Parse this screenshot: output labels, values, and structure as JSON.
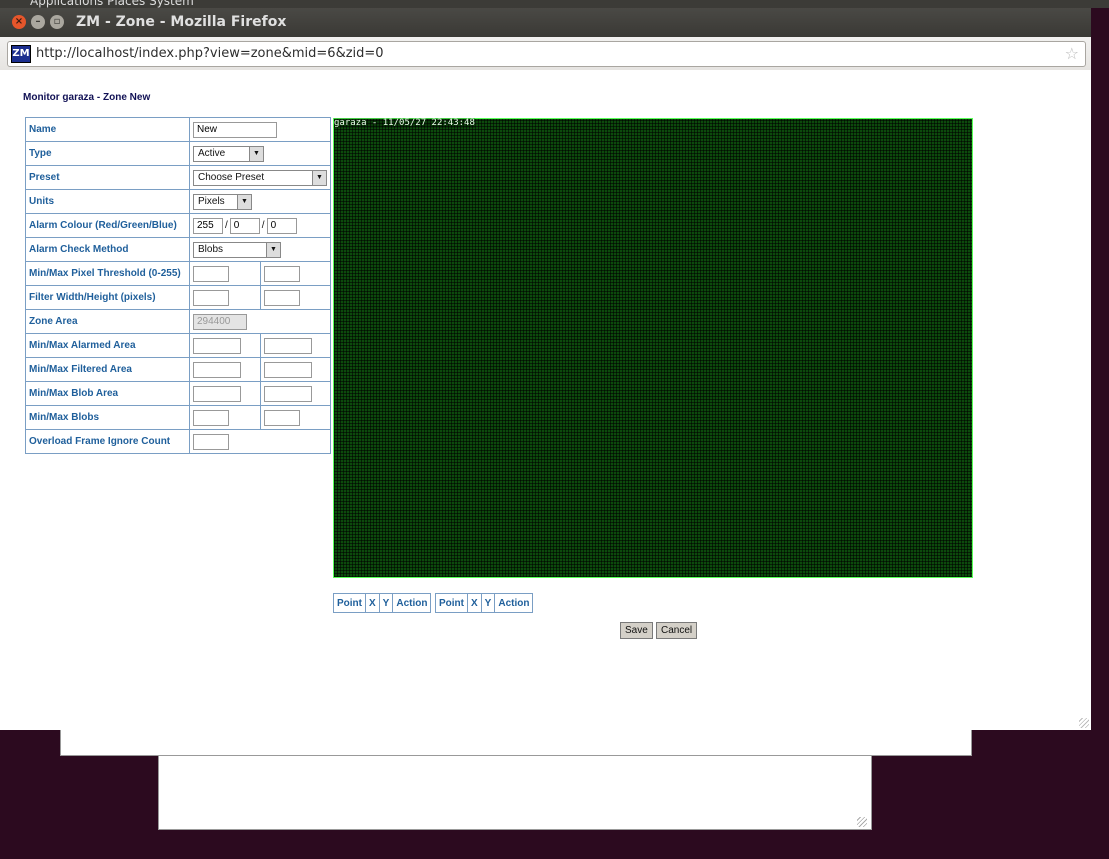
{
  "desktop": {
    "panel_text": "Applications  Places  System"
  },
  "window": {
    "title": "ZM - Zone - Mozilla Firefox"
  },
  "browser": {
    "url": "http://localhost/index.php?view=zone&mid=6&zid=0",
    "favicon_text": "ZM"
  },
  "page": {
    "heading": "Monitor garaza - Zone New",
    "fields": {
      "name": {
        "label": "Name",
        "value": "New"
      },
      "type": {
        "label": "Type",
        "value": "Active"
      },
      "preset": {
        "label": "Preset",
        "value": "Choose Preset"
      },
      "units": {
        "label": "Units",
        "value": "Pixels"
      },
      "alarm_colour": {
        "label": "Alarm Colour (Red/Green/Blue)",
        "red": "255",
        "green": "0",
        "blue": "0"
      },
      "check_method": {
        "label": "Alarm Check Method",
        "value": "Blobs"
      },
      "pixel_threshold": {
        "label": "Min/Max Pixel Threshold (0-255)",
        "min": "",
        "max": ""
      },
      "filter_size": {
        "label": "Filter Width/Height (pixels)",
        "width": "",
        "height": ""
      },
      "zone_area": {
        "label": "Zone Area",
        "value": "294400"
      },
      "alarmed_area": {
        "label": "Min/Max Alarmed Area",
        "min": "",
        "max": ""
      },
      "filtered_area": {
        "label": "Min/Max Filtered Area",
        "min": "",
        "max": ""
      },
      "blob_area": {
        "label": "Min/Max Blob Area",
        "min": "",
        "max": ""
      },
      "blobs": {
        "label": "Min/Max Blobs",
        "min": "",
        "max": ""
      },
      "overload": {
        "label": "Overload Frame Ignore Count",
        "value": ""
      }
    },
    "image": {
      "caption": "garaza - 11/05/27 22:43:48"
    },
    "points_table": {
      "headers": [
        "Point",
        "X",
        "Y",
        "Action"
      ]
    },
    "buttons": {
      "save": "Save",
      "cancel": "Cancel"
    }
  },
  "colors": {
    "label_blue": "#1f5f9b",
    "heading_navy": "#111155",
    "table_border": "#7a9ec4",
    "zone_outline": "#57ff57",
    "desktop_bg": "#2c0a1f"
  }
}
